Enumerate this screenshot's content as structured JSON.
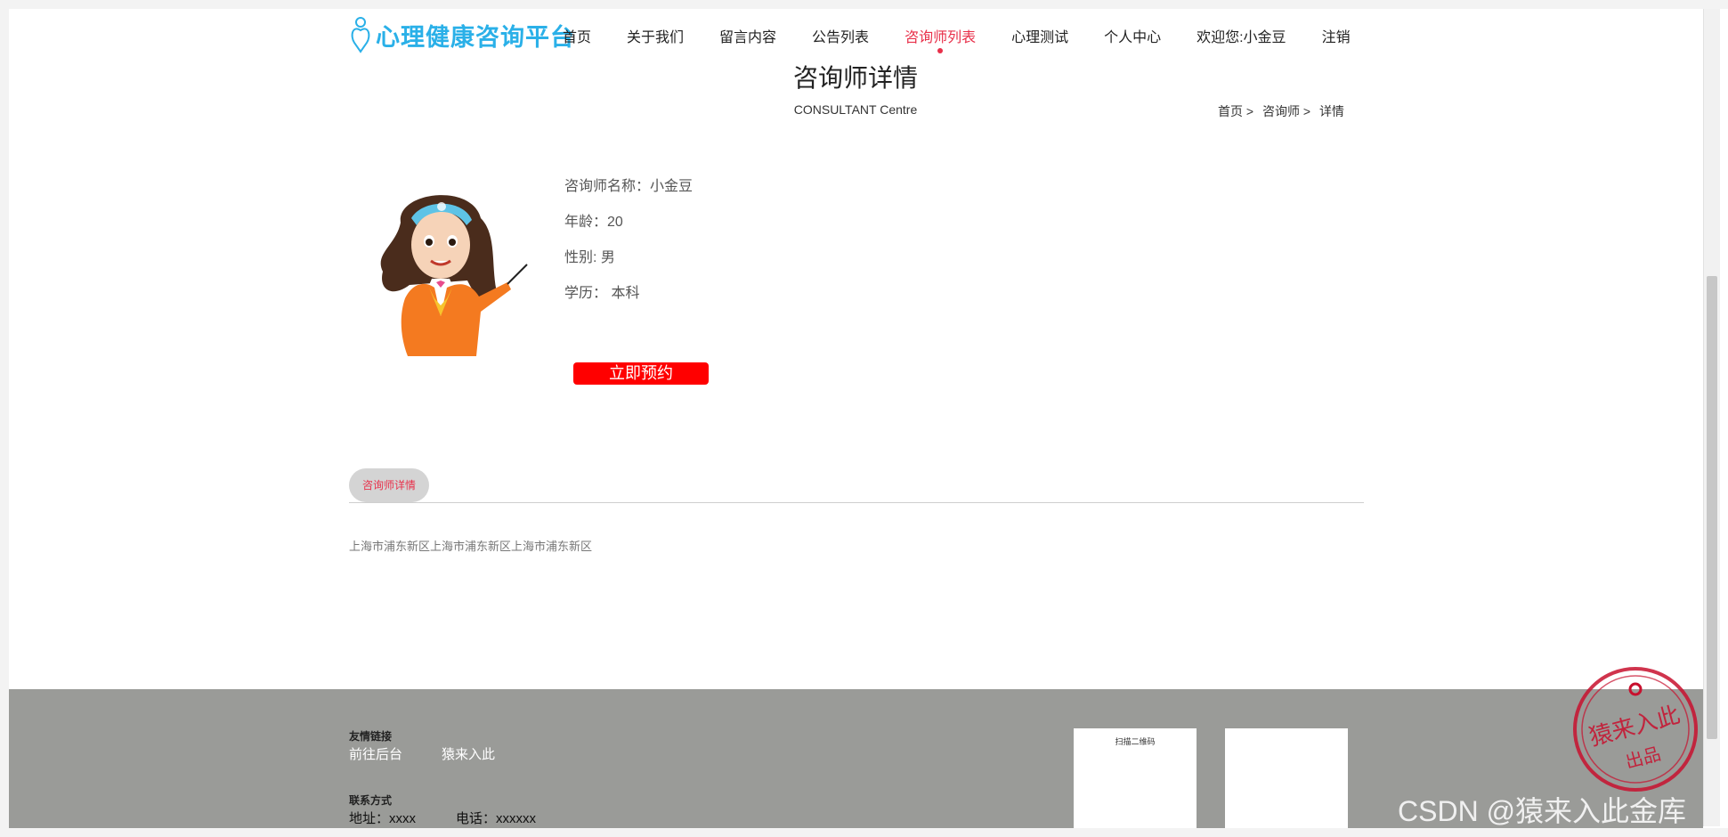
{
  "header": {
    "logo_text": "心理健康咨询平台",
    "nav": [
      {
        "label": "首页",
        "active": false
      },
      {
        "label": "关于我们",
        "active": false
      },
      {
        "label": "留言内容",
        "active": false
      },
      {
        "label": "公告列表",
        "active": false
      },
      {
        "label": "咨询师列表",
        "active": true
      },
      {
        "label": "心理测试",
        "active": false
      },
      {
        "label": "个人中心",
        "active": false
      },
      {
        "label": "欢迎您:小金豆",
        "active": false
      },
      {
        "label": "注销",
        "active": false
      }
    ]
  },
  "page": {
    "title": "咨询师详情",
    "subtitle": "CONSULTANT Centre",
    "breadcrumb": [
      "首页 >",
      "咨询师 >",
      "详情"
    ]
  },
  "consultant": {
    "name": "咨询师名称：小金豆",
    "age": "年龄：20",
    "gender": "性别: 男",
    "education": "学历：  本科",
    "book_label": "立即预约"
  },
  "detail": {
    "tab_label": "咨询师详情",
    "description": "上海市浦东新区上海市浦东新区上海市浦东新区"
  },
  "footer": {
    "links_heading": "友情链接",
    "links": [
      "前往后台",
      "猿来入此"
    ],
    "contact_heading": "联系方式",
    "address": "地址：xxxx",
    "phone": "电话：xxxxxx",
    "qr_caption": "扫描二维码"
  },
  "watermark": "CSDN @猿来入此金库",
  "stamp_text": "猿来入此 出品",
  "colors": {
    "accent": "#e8304a",
    "logo": "#2ab0e8",
    "footer_bg": "#9a9b98",
    "button": "#ff0000"
  }
}
